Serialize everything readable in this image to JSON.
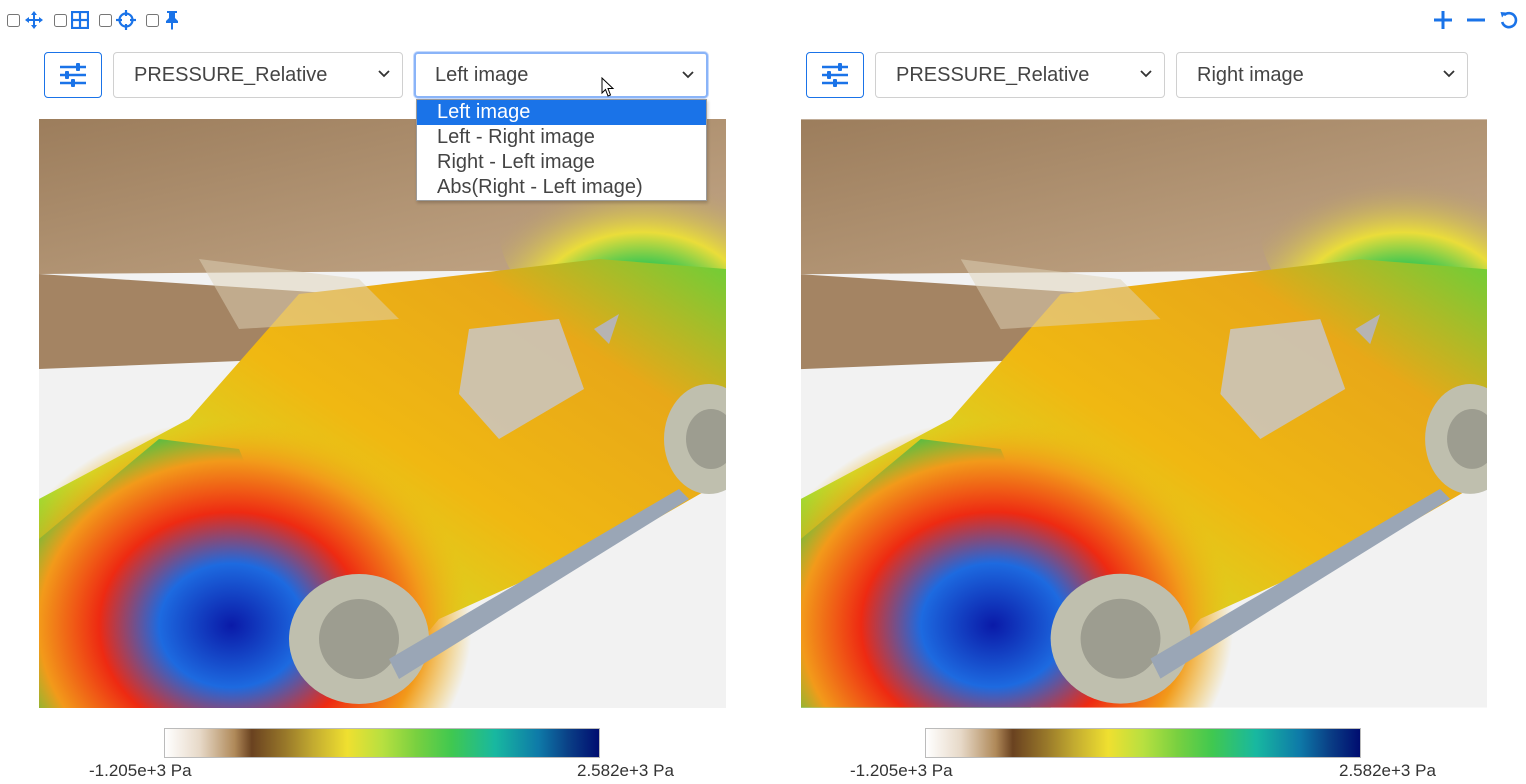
{
  "toolbar": {
    "tools": [
      {
        "icon": "move-icon",
        "checked": false
      },
      {
        "icon": "grid-icon",
        "checked": false
      },
      {
        "icon": "crosshair-icon",
        "checked": false
      },
      {
        "icon": "pin-icon",
        "checked": false
      }
    ],
    "right_icons": [
      "plus-icon",
      "minus-icon",
      "reset-icon"
    ]
  },
  "colors": {
    "accent": "#1a73e8",
    "select_border": "#d0d0d0",
    "dropdown_selected_bg": "#1a73e8"
  },
  "left_panel": {
    "variable": "PRESSURE_Relative",
    "image_mode": "Left image",
    "dropdown_open": true,
    "dropdown_options": [
      "Left image",
      "Left - Right image",
      "Right - Left image",
      "Abs(Right - Left image)"
    ],
    "dropdown_selected": 0,
    "colorbar_min": "-1.205e+3  Pa",
    "colorbar_max": "2.582e+3  Pa"
  },
  "right_panel": {
    "variable": "PRESSURE_Relative",
    "image_mode": "Right image",
    "colorbar_min": "-1.205e+3  Pa",
    "colorbar_max": "2.582e+3  Pa"
  }
}
